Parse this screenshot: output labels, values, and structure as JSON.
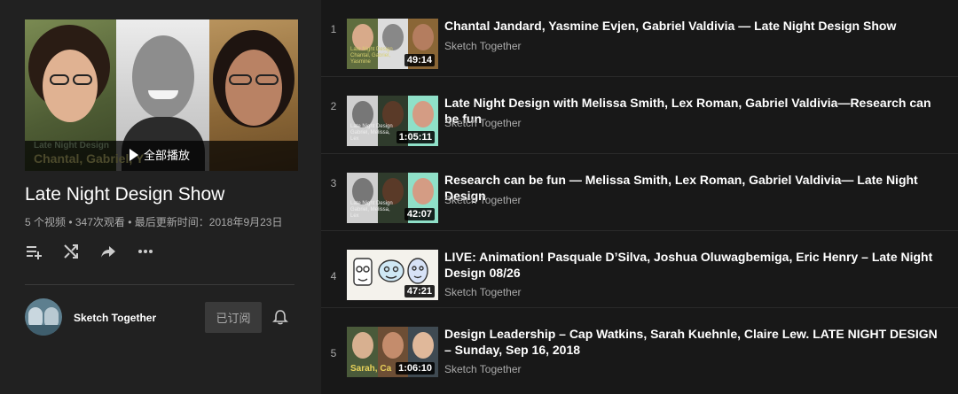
{
  "playlist": {
    "hero_caption_line1": "Late Night Design",
    "hero_caption_line2": "Chantal, Gabriel, Y",
    "play_all_label": "全部播放",
    "title": "Late Night Design Show",
    "meta": "5 个视频 • 347次观看 • 最后更新时间：2018年9月23日",
    "actions": [
      "add-to-queue-icon",
      "shuffle-icon",
      "share-icon",
      "more-icon"
    ]
  },
  "owner": {
    "name": "Sketch Together",
    "subscribe_label": "已订阅"
  },
  "videos": [
    {
      "index": "1",
      "title": "Chantal Jandard, Yasmine Evjen, Gabriel Valdivia — Late Night Design Show",
      "channel": "Sketch Together",
      "duration": "49:14",
      "thumb_caption": "Late Night Design Chantal, Gabriel, Yasmine"
    },
    {
      "index": "2",
      "title": "Late Night Design with Melissa Smith, Lex Roman, Gabriel Valdivia—Research can be fun",
      "channel": "Sketch Together",
      "duration": "1:05:11",
      "thumb_caption": "Late Night Design Gabriel, Melissa, Lex"
    },
    {
      "index": "3",
      "title": "Research can be fun — Melissa Smith, Lex Roman, Gabriel Valdivia— Late Night Design",
      "channel": "Sketch Together",
      "duration": "42:07",
      "thumb_caption": "Late Night Design Gabriel, Melissa, Lex"
    },
    {
      "index": "4",
      "title": "LIVE: Animation! Pasquale D’Silva, Joshua Oluwagbemiga, Eric Henry – Late Night Design 08/26",
      "channel": "Sketch Together",
      "duration": "47:21",
      "thumb_caption": ""
    },
    {
      "index": "5",
      "title": "Design Leadership – Cap Watkins, Sarah Kuehnle, Claire Lew. LATE NIGHT DESIGN – Sunday, Sep 16, 2018",
      "channel": "Sketch Together",
      "duration": "1:06:10",
      "thumb_caption": "Sarah, Ca"
    }
  ],
  "colors": {
    "background": "#181818",
    "panel": "#212121",
    "text_secondary": "#aaaaaa",
    "subscribe_bg": "#3a3a3a"
  }
}
